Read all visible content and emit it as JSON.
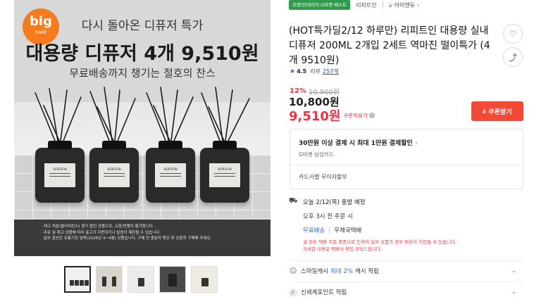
{
  "hero": {
    "badge_big": "big",
    "badge_sale": "sale",
    "headline1": "다시 돌아온 디퓨저 특가",
    "headline2": "대용량 디퓨저 4개 9,510원",
    "headline3": "무료배송까지 챙기는 절호의 찬스",
    "bottle_label": "REPEATIN",
    "notices": [
      "-재고 처분(클리어런스) 원가 할인 상품으로, 교환/반품이 불가합니다.",
      "-주문 및 재고 상황에 따라 출고가 지연되거나 발송이 제한될 수 있습니다.",
      "-일부 옵션은 유통기한 임박(2026년 3~4월) 상품입니다. 구매 전 충분히 확인 후 신중히 구매해 주세요."
    ]
  },
  "thumbnails": [
    {
      "name": "thumb-1",
      "active": true
    },
    {
      "name": "thumb-2",
      "active": false
    },
    {
      "name": "thumb-3",
      "active": false
    },
    {
      "name": "thumb-4",
      "active": false
    },
    {
      "name": "thumb-5",
      "active": false
    }
  ],
  "badges": {
    "best": "조명/인테리어 G마켓 베스트",
    "seller": "리피트인",
    "shop_name": "아이엔듀",
    "shop_chevron": "›"
  },
  "product": {
    "title": "(HOT특가딜2/12 하루만) 리피트인 대용량 실내 디퓨저 200ML 2개입 2세트 역마진 떨이특가 (4개 9510원)",
    "rating": "4.5",
    "review_label": "리뷰",
    "review_count": "257개"
  },
  "price": {
    "discount": "12%",
    "original": "10,900원",
    "price": "10,800원",
    "coupon_price": "9,510원",
    "coupon_label": "쿠폰적용가",
    "coupon_button": "쿠폰받기",
    "info_icon": "i"
  },
  "promo": {
    "title": "30만원 이상 결제 시 최대 1만원 결제할인",
    "chevron": "›",
    "sub": "G마켓 삼성카드",
    "installment": "카드사별 무이자할부"
  },
  "shipping": {
    "eta": "오늘 2/12(목) 출발 예정",
    "cutoff": "오후 3시 전 주문 시",
    "service": "무료배송",
    "carrier": "우체국택배",
    "warn1": "설 연휴 택배 주문 폭증으로 인하여 일부 상품의 경우 배송이 지연될 수 있습니다.",
    "warn2": "자세한 내용은 택배사 확인 부탁드립니다."
  },
  "rows": {
    "smile_pre": "스마일캐시",
    "smile_hl": "최대 2%",
    "smile_post": "캐시 적립",
    "point": "신세계포인트 적립",
    "chevron": "⌄"
  },
  "icons": {
    "heart": "♡",
    "share": "⤴",
    "star": "★",
    "home": "⌂",
    "truck": "⛟",
    "download": "⤓",
    "smile": "☺",
    "point": "Ⓟ"
  },
  "colors": {
    "accent_red": "#f43142",
    "coupon_button": "#f44a35",
    "best_badge": "#2e9a4a",
    "link_blue": "#2a6fd6",
    "sale_orange": "#f47c1f"
  }
}
